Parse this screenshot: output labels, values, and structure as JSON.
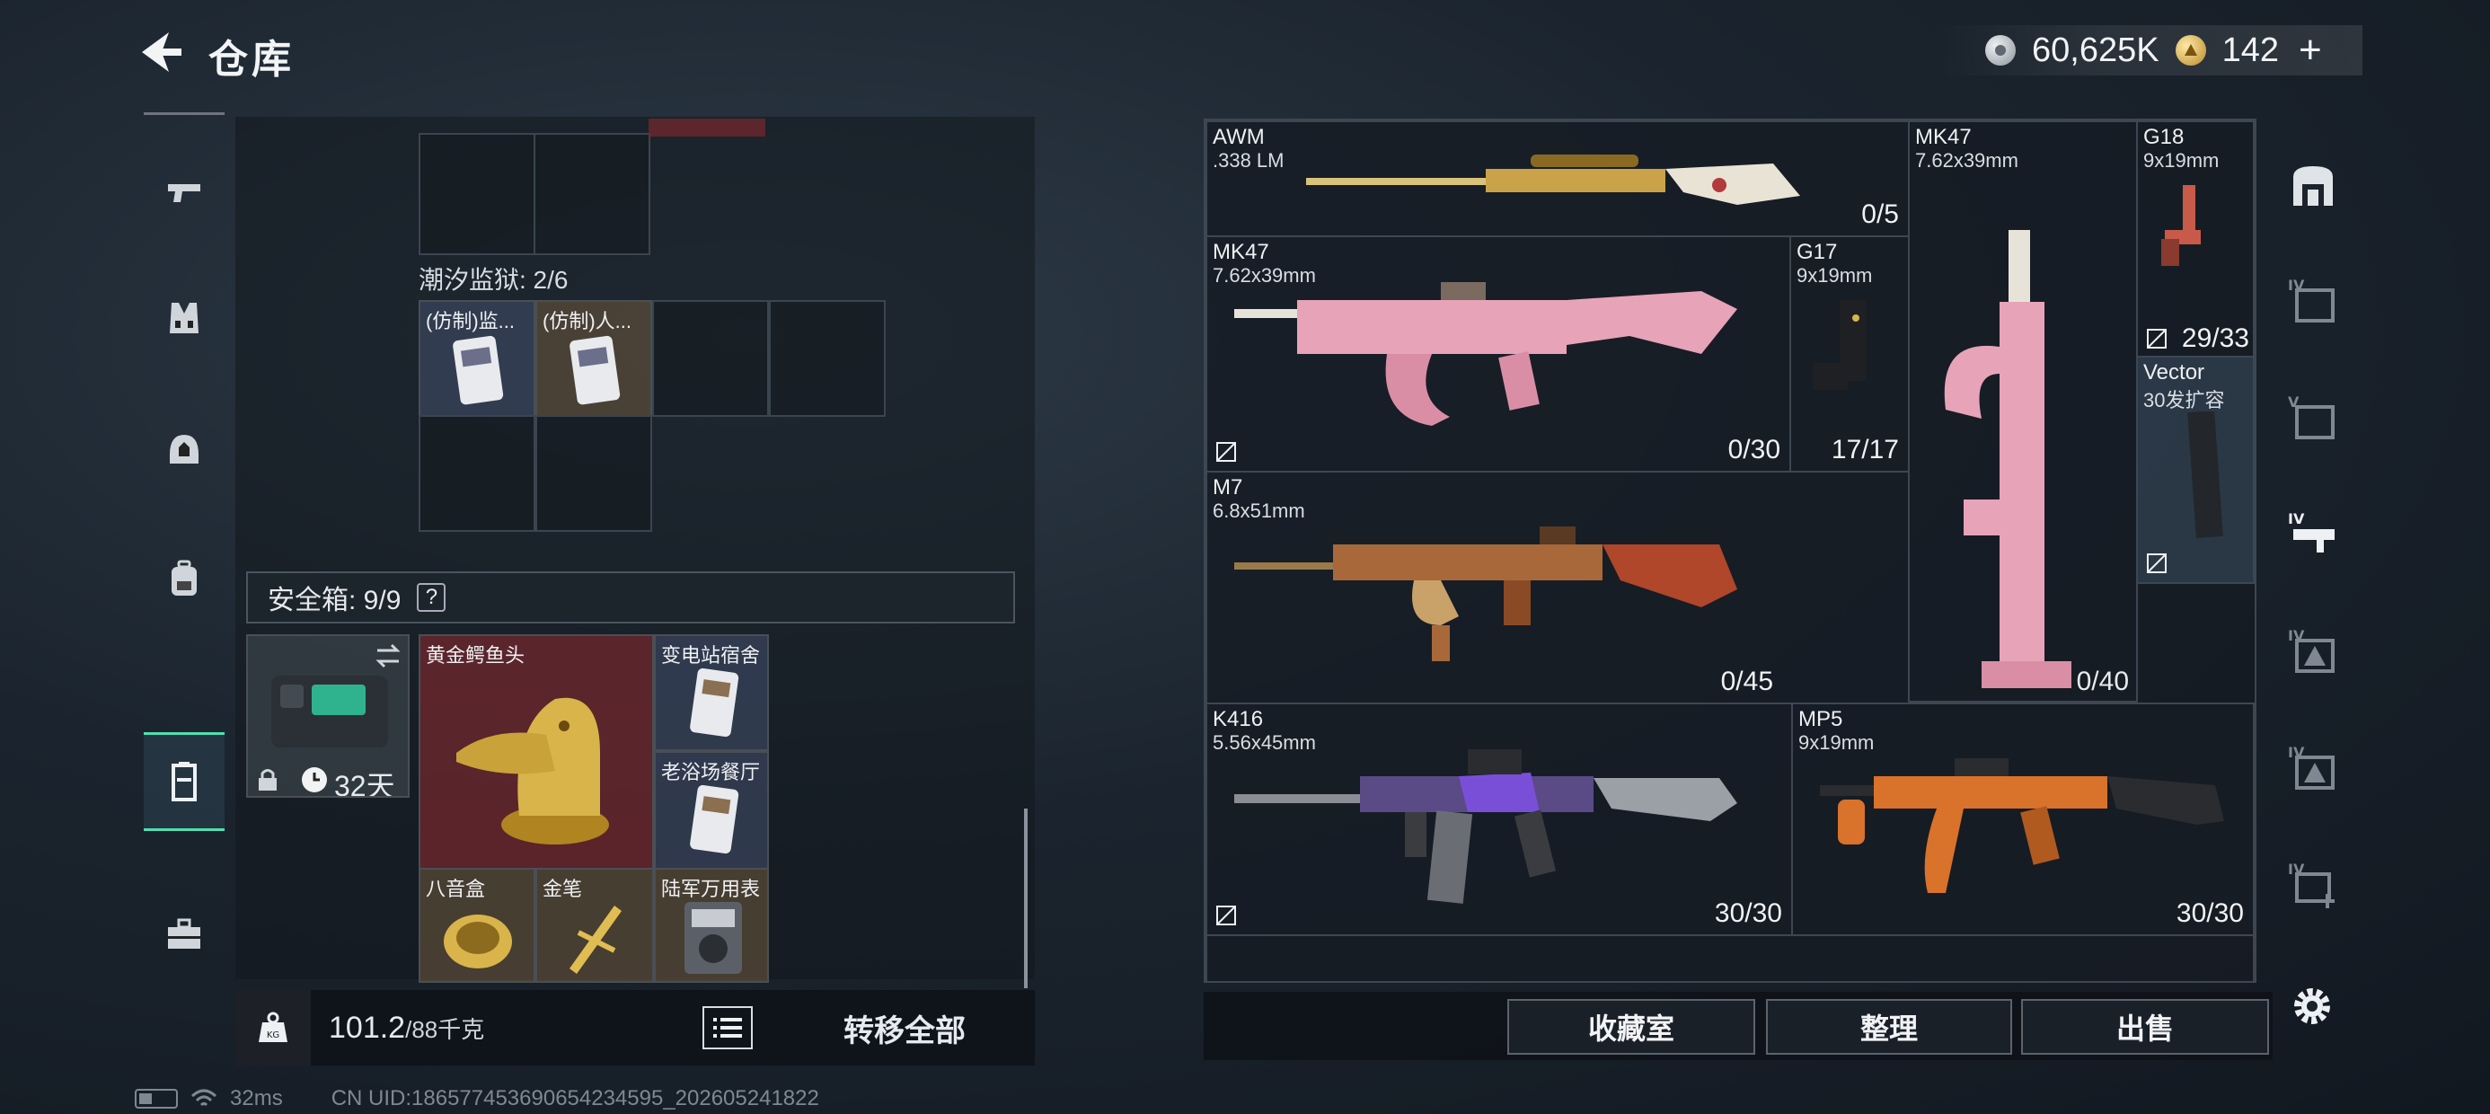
{
  "header": {
    "title": "仓库",
    "currency": [
      {
        "icon": "silver-coin-icon",
        "value": "60,625K"
      },
      {
        "icon": "gold-coin-icon",
        "value": "142"
      }
    ],
    "plus": "+"
  },
  "left_nav": [
    {
      "icon": "pistol-icon",
      "active": false
    },
    {
      "icon": "armor-vest-icon",
      "active": false
    },
    {
      "icon": "helmet-icon",
      "active": false
    },
    {
      "icon": "backpack-icon",
      "active": false
    },
    {
      "icon": "container-icon",
      "active": true
    },
    {
      "icon": "toolbox-icon",
      "active": false
    }
  ],
  "inventory": {
    "section_label": "潮汐监狱: 2/6",
    "items": [
      {
        "label": "(仿制)监..."
      },
      {
        "label": "(仿制)人..."
      }
    ],
    "safebox_label": "安全箱: 9/9",
    "safebox_help": "?",
    "safebox_timer": "32天",
    "safebox_items": [
      {
        "label": "黄金鳄鱼头"
      },
      {
        "label": "变电站宿舍"
      },
      {
        "label": "老浴场餐厅"
      },
      {
        "label": "八音盒"
      },
      {
        "label": "金笔"
      },
      {
        "label": "陆军万用表"
      }
    ]
  },
  "weight": {
    "value": "101.2",
    "capacity": "/88千克"
  },
  "transfer_all": "转移全部",
  "weapons": [
    {
      "name": "AWM",
      "ammo": ".338 LM",
      "count": "0/5"
    },
    {
      "name": "MK47",
      "ammo": "7.62x39mm",
      "count": ""
    },
    {
      "name": "G18",
      "ammo": "9x19mm",
      "count": "29/33"
    },
    {
      "name": "MK47",
      "ammo": "7.62x39mm",
      "count": "0/30"
    },
    {
      "name": "G17",
      "ammo": "9x19mm",
      "count": "17/17"
    },
    {
      "name": "Vector",
      "ammo": "30发扩容",
      "count": ""
    },
    {
      "name": "M7",
      "ammo": "6.8x51mm",
      "count": "0/45"
    },
    {
      "name": "",
      "ammo": "",
      "count": "0/40"
    },
    {
      "name": "K416",
      "ammo": "5.56x45mm",
      "count": "30/30"
    },
    {
      "name": "MP5",
      "ammo": "9x19mm",
      "count": "30/30"
    }
  ],
  "actions": {
    "collection": "收藏室",
    "sort": "整理",
    "sell": "出售"
  },
  "status": {
    "ping": "32ms",
    "uid": "CN UID:186577453690654234595_202605241822"
  },
  "colors": {
    "accent": "#4fe0b0",
    "pink_skin": "#e7a3b8",
    "gold_skin": "#c9a24a",
    "orange_skin": "#d9722a",
    "purple_skin": "#7a4fd8"
  }
}
